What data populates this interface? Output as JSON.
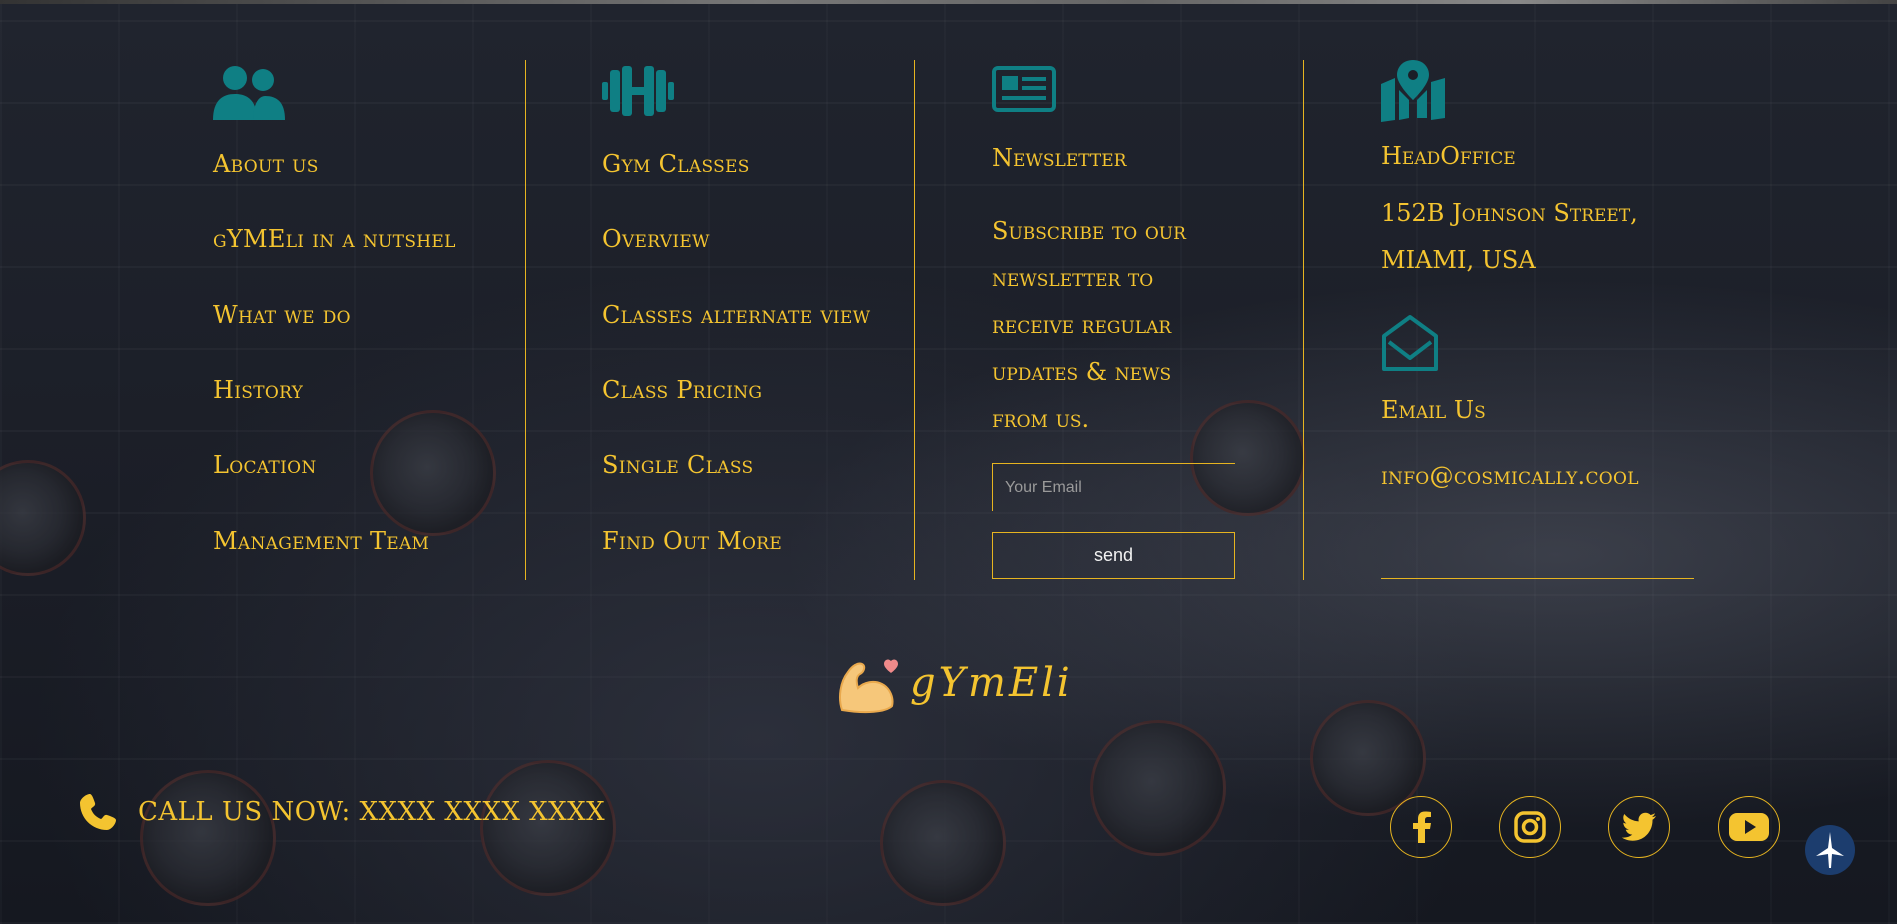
{
  "colors": {
    "accent": "#f4c430",
    "icon_teal": "#0f7f84",
    "divider": "#e6b420",
    "to_top_bg": "#1c3d6e"
  },
  "col1": {
    "icon": "users-icon",
    "links": [
      "About us",
      "gYMEli in a nutshel",
      "What we do",
      "History",
      "Location",
      "Management Team"
    ]
  },
  "col2": {
    "icon": "dumbbell-icon",
    "links": [
      "Gym Classes",
      "Overview",
      "Classes alternate view",
      "Class Pricing",
      "Single Class",
      "Find Out More"
    ]
  },
  "col3": {
    "icon": "newspaper-icon",
    "heading": "Newsletter",
    "text": "Subscribe to our newsletter to receive regular updates & news from us.",
    "email_placeholder": "Your Email",
    "send_label": "send"
  },
  "col4": {
    "icon": "map-location-icon",
    "heading": "HeadOffice",
    "address": "152B Johnson Street, MIAMI, USA",
    "email_icon": "envelope-open-icon",
    "email_heading": "Email Us",
    "email": "info@cosmically.cool"
  },
  "logo": {
    "icon": "flexed-bicep-icon",
    "text": "gYmEli"
  },
  "call": {
    "icon": "phone-icon",
    "text": "CALL US NOW: XXXX XXXX XXXX"
  },
  "social": [
    "facebook-icon",
    "instagram-icon",
    "twitter-icon",
    "youtube-icon"
  ],
  "to_top": {
    "icon": "arrow-up-icon"
  }
}
